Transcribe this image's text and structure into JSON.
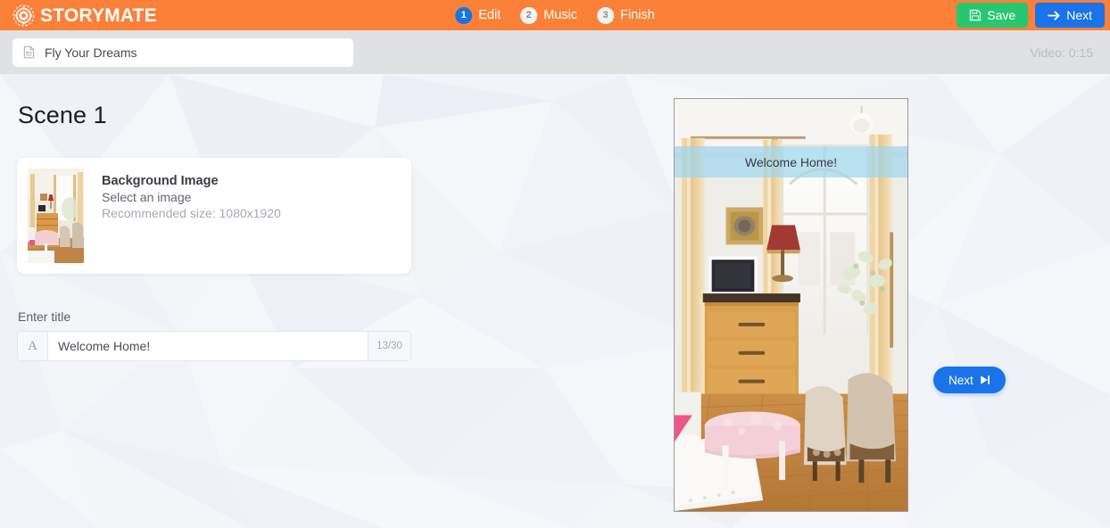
{
  "header": {
    "brand": "STORYMATE",
    "logo_icon": "aperture-camera-icon",
    "steps": [
      {
        "num": "1",
        "label": "Edit",
        "active": true
      },
      {
        "num": "2",
        "label": "Music",
        "active": false
      },
      {
        "num": "3",
        "label": "Finish",
        "active": false
      }
    ],
    "save_label": "Save",
    "save_icon": "floppy-disk-icon",
    "next_label": "Next",
    "next_icon": "arrow-right-icon",
    "colors": {
      "header_bg": "#fb8038",
      "save_bg": "#28c76f",
      "next_bg": "#1a73e8",
      "step_active_bg": "#1375e8"
    }
  },
  "subbar": {
    "project_icon": "document-icon",
    "project_name": "Fly Your Dreams",
    "project_placeholder": "Project name",
    "video_duration": "Video: 0:15"
  },
  "main": {
    "scene_title": "Scene 1",
    "background_card": {
      "title": "Background Image",
      "subtitle": "Select an image",
      "hint": "Recommended size: 1080x1920",
      "thumbnail_alt": "living-room-interior"
    },
    "title_field": {
      "label": "Enter title",
      "prefix_glyph": "A",
      "value": "Welcome Home!",
      "placeholder": "Enter title",
      "counter": "13/30"
    }
  },
  "preview": {
    "overlay_text": "Welcome Home!",
    "overlay_color": "#9fd6ec",
    "next_label": "Next",
    "next_icon": "skip-forward-icon",
    "image_alt": "living-room-interior"
  }
}
